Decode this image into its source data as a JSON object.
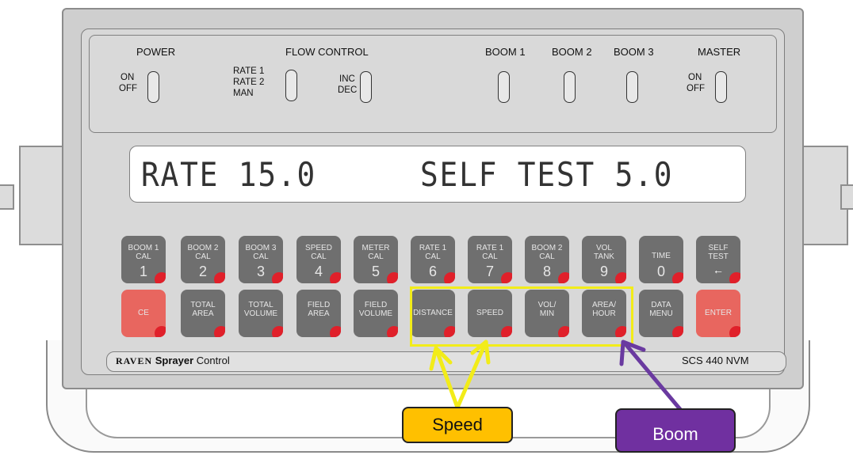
{
  "panel": {
    "power": {
      "title": "POWER",
      "on": "ON",
      "off": "OFF"
    },
    "flow_control": {
      "title": "FLOW CONTROL",
      "rate1": "RATE 1",
      "rate2": "RATE 2",
      "man": "MAN",
      "inc": "INC",
      "dec": "DEC"
    },
    "boom1": "BOOM 1",
    "boom2": "BOOM 2",
    "boom3": "BOOM 3",
    "master": {
      "title": "MASTER",
      "on": "ON",
      "off": "OFF"
    }
  },
  "display": {
    "left": "RATE  15.0",
    "right": "SELF  TEST  5.0"
  },
  "keys_row1": [
    {
      "line1": "BOOM 1",
      "line2": "CAL",
      "num": "1"
    },
    {
      "line1": "BOOM 2",
      "line2": "CAL",
      "num": "2"
    },
    {
      "line1": "BOOM 3",
      "line2": "CAL",
      "num": "3"
    },
    {
      "line1": "SPEED",
      "line2": "CAL",
      "num": "4"
    },
    {
      "line1": "METER",
      "line2": "CAL",
      "num": "5"
    },
    {
      "line1": "RATE 1",
      "line2": "CAL",
      "num": "6"
    },
    {
      "line1": "RATE 1",
      "line2": "CAL",
      "num": "7"
    },
    {
      "line1": "BOOM 2",
      "line2": "CAL",
      "num": "8"
    },
    {
      "line1": "VOL",
      "line2": "TANK",
      "num": "9"
    },
    {
      "line1": "TIME",
      "line2": "",
      "num": "0"
    },
    {
      "line1": "SELF",
      "line2": "TEST",
      "num": "←"
    }
  ],
  "keys_row2": [
    {
      "line1": "CE",
      "line2": ""
    },
    {
      "line1": "TOTAL",
      "line2": "AREA"
    },
    {
      "line1": "TOTAL",
      "line2": "VOLUME"
    },
    {
      "line1": "FIELD",
      "line2": "AREA"
    },
    {
      "line1": "FIELD",
      "line2": "VOLUME"
    },
    {
      "line1": "DISTANCE",
      "line2": ""
    },
    {
      "line1": "SPEED",
      "line2": ""
    },
    {
      "line1": "VOL/",
      "line2": "MIN"
    },
    {
      "line1": "AREA/",
      "line2": "HOUR"
    },
    {
      "line1": "DATA",
      "line2": "MENU"
    },
    {
      "line1": "ENTER",
      "line2": ""
    }
  ],
  "footer": {
    "brand_raven": "RAVEN",
    "brand_sprayer": "Sprayer",
    "brand_control": "Control",
    "model": "SCS 440 NVM"
  },
  "callouts": {
    "speed": "Speed",
    "boom": "Boom"
  },
  "colors": {
    "key_gray": "#6f6f6f",
    "key_red": "#e8665f",
    "highlight": "#f2ec19",
    "speed_callout": "#ffc000",
    "boom_callout": "#7030a0",
    "arrow_purple": "#6a3aa0"
  }
}
